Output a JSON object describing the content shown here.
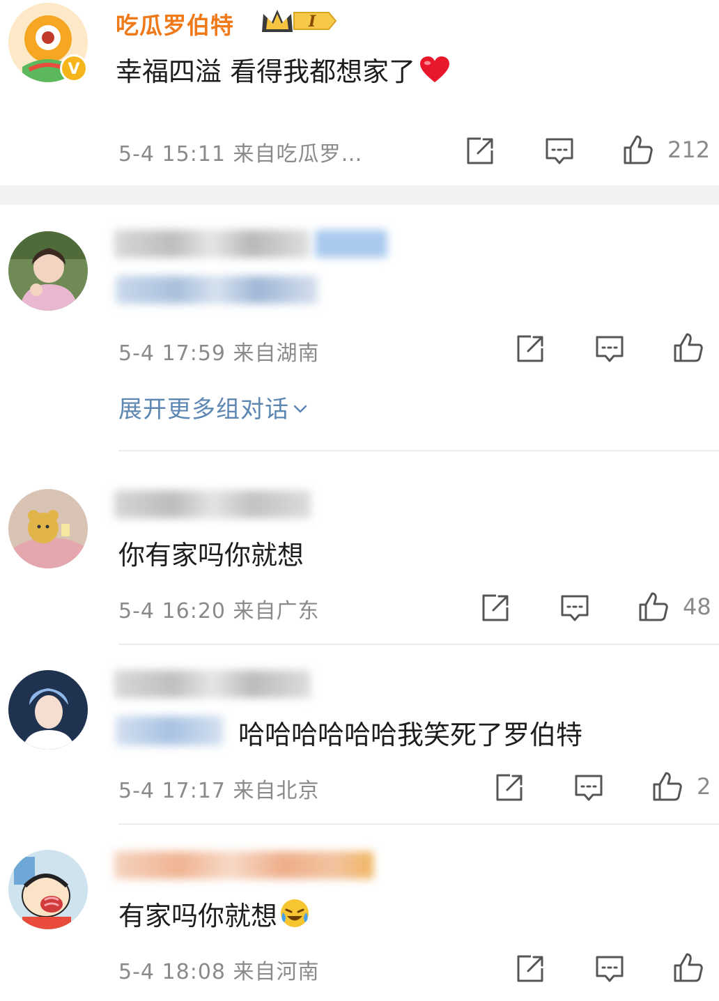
{
  "comments": [
    {
      "username": "吃瓜罗伯特",
      "vip_level": "I",
      "text": "幸福四溢 看得我都想家了",
      "emoji": "heart-emoji",
      "meta": "5-4 15:11  来自吃瓜罗…",
      "likes": "212"
    },
    {
      "text_blurred": true,
      "meta": "5-4 17:59  来自湖南",
      "likes": "",
      "expand_label": "展开更多组对话"
    },
    {
      "text": "你有家吗你就想",
      "meta": "5-4 16:20  来自广东",
      "likes": "48"
    },
    {
      "text": "哈哈哈哈哈哈我笑死了罗伯特",
      "meta": "5-4 17:17  来自北京",
      "likes": "2"
    },
    {
      "text": "有家吗你就想",
      "emoji": "laughing-crying-emoji",
      "meta": "5-4 18:08  来自河南",
      "likes": ""
    }
  ],
  "colors": {
    "username": "#f07a1a",
    "link": "#5c87b3",
    "meta": "#8a8a8a",
    "separator": "#ececec"
  }
}
